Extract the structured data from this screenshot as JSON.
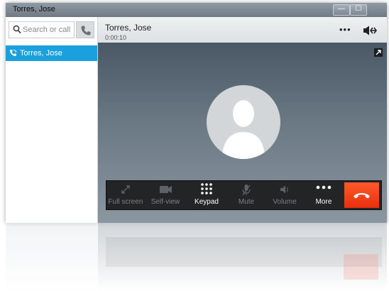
{
  "window": {
    "title": "Torres, Jose",
    "minimize_glyph": "—",
    "maximize_glyph": "☐"
  },
  "sidebar": {
    "search_placeholder": "Search or call",
    "contact": {
      "label": "Torres, Jose",
      "icon": "phone-active-icon"
    }
  },
  "call": {
    "name": "Torres, Jose",
    "duration": "0:00:10",
    "more_glyph": "•••"
  },
  "toolbar": {
    "items": [
      {
        "label": "Full screen",
        "icon": "fullscreen-icon",
        "enabled": false
      },
      {
        "label": "Self-view",
        "icon": "camera-icon",
        "enabled": false
      },
      {
        "label": "Keypad",
        "icon": "keypad-icon",
        "enabled": true
      },
      {
        "label": "Mute",
        "icon": "mic-muted-icon",
        "enabled": false
      },
      {
        "label": "Volume",
        "icon": "speaker-icon",
        "enabled": false
      },
      {
        "label": "More",
        "icon": "more-icon",
        "enabled": true
      }
    ],
    "end_call_icon": "hang-up-icon"
  },
  "colors": {
    "accent": "#1aa0dd",
    "end_call": "#f43c14",
    "toolbar_bg": "#222426"
  }
}
